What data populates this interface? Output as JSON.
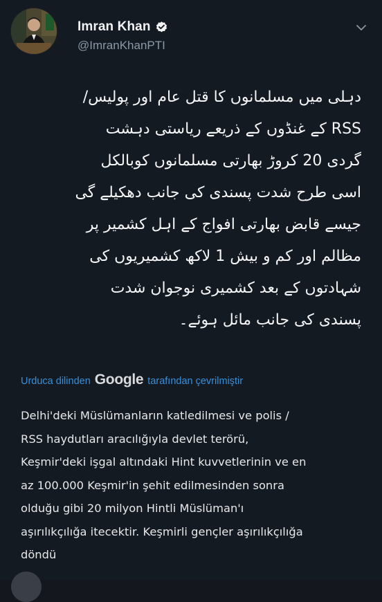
{
  "author": {
    "display_name": "Imran Khan",
    "handle": "@ImranKhanPTI",
    "verified_icon": "verified-badge-icon",
    "avatar_icon": "profile-photo"
  },
  "tweet": {
    "original_lines": [
      "دہلی میں مسلمانوں کا قتل عام اور پولیس/",
      "RSS کے غنڈوں کے ذریعے ریاستی دہشت",
      "گردی 20 کروڑ بھارتی مسلمانوں کوبالکل",
      "اسی طرح شدت پسندی کی جانب دھکیلے گی",
      "جیسے قابض بھارتی افواج کے اہل کشمیر پر",
      "مظالم اور کم و بیش 1 لاکھ کشمیریوں کی",
      "شہادتوں کے بعد کشمیری نوجوان شدت",
      "پسندی کی جانب مائل ہوئے۔"
    ],
    "translation_label_before": "Urduca dilinden",
    "translation_brand": "Google",
    "translation_label_after": "tarafından çevrilmiştir",
    "translated_lines": [
      "Delhi'deki Müslümanların katledilmesi ve polis /",
      "RSS haydutları aracılığıyla devlet terörü,",
      "Keşmir'deki işgal altındaki Hint kuvvetlerinin ve en",
      "az 100.000 Keşmir'in şehit edilmesinden sonra",
      "olduğu gibi 20 milyon Hintli Müslüman'ı",
      "aşırılıkçılığa itecektir. Keşmirli gençler aşırılıkçılığa",
      "döndü"
    ]
  },
  "colors": {
    "background": "#141a22",
    "link": "#3a8fd9",
    "verified": "#1d9bf0",
    "muted": "#8b98a5"
  }
}
